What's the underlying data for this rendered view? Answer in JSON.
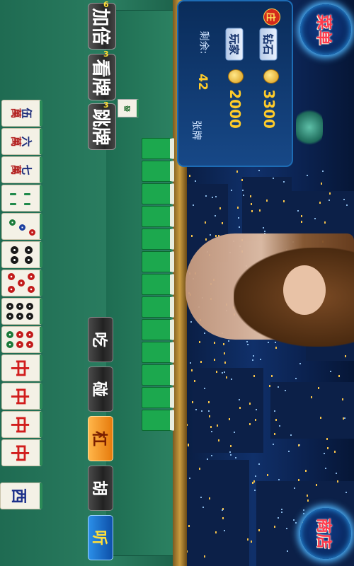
{
  "game": {
    "menu_buttons": {
      "top": "菜单",
      "bottom": "商店"
    },
    "info": {
      "dealer_badge": "庄",
      "rows": [
        {
          "label": "钻石",
          "value": "3300"
        },
        {
          "label": "玩家",
          "value": "2000"
        }
      ],
      "remaining_label": "剩余:",
      "remaining_count": "42",
      "remaining_unit": "张牌"
    },
    "side_buttons": [
      {
        "label": "加倍",
        "count": "6"
      },
      {
        "label": "看牌",
        "count": "3"
      },
      {
        "label": "跳牌",
        "count": "3"
      }
    ],
    "actions": [
      {
        "id": "chi",
        "label": "吃"
      },
      {
        "id": "peng",
        "label": "碰"
      },
      {
        "id": "gang",
        "label": "杠"
      },
      {
        "id": "hu",
        "label": "胡"
      },
      {
        "id": "ting",
        "label": "听"
      }
    ],
    "last_discard_tile": "發",
    "drawn_tile": "西",
    "hand": [
      {
        "kind": "wan",
        "num": "伍",
        "unit": "萬"
      },
      {
        "kind": "wan",
        "num": "六",
        "unit": "萬"
      },
      {
        "kind": "wan",
        "num": "七",
        "unit": "萬"
      },
      {
        "kind": "bamboo",
        "num": "2"
      },
      {
        "kind": "dots",
        "num": "3"
      },
      {
        "kind": "dots",
        "num": "4"
      },
      {
        "kind": "dots",
        "num": "5"
      },
      {
        "kind": "dots",
        "num": "6"
      },
      {
        "kind": "dots",
        "num": "6b"
      },
      {
        "kind": "zhong",
        "num": "中"
      },
      {
        "kind": "zhong",
        "num": "中"
      },
      {
        "kind": "zhong",
        "num": "中"
      },
      {
        "kind": "zhong",
        "num": "中"
      }
    ],
    "opponent_tile_count": 13,
    "colors": {
      "felt": "#2a7d60",
      "tile_back": "#1ca84e",
      "accent_gold": "#ffcc2a",
      "menu_red": "#ff3b4c"
    }
  }
}
